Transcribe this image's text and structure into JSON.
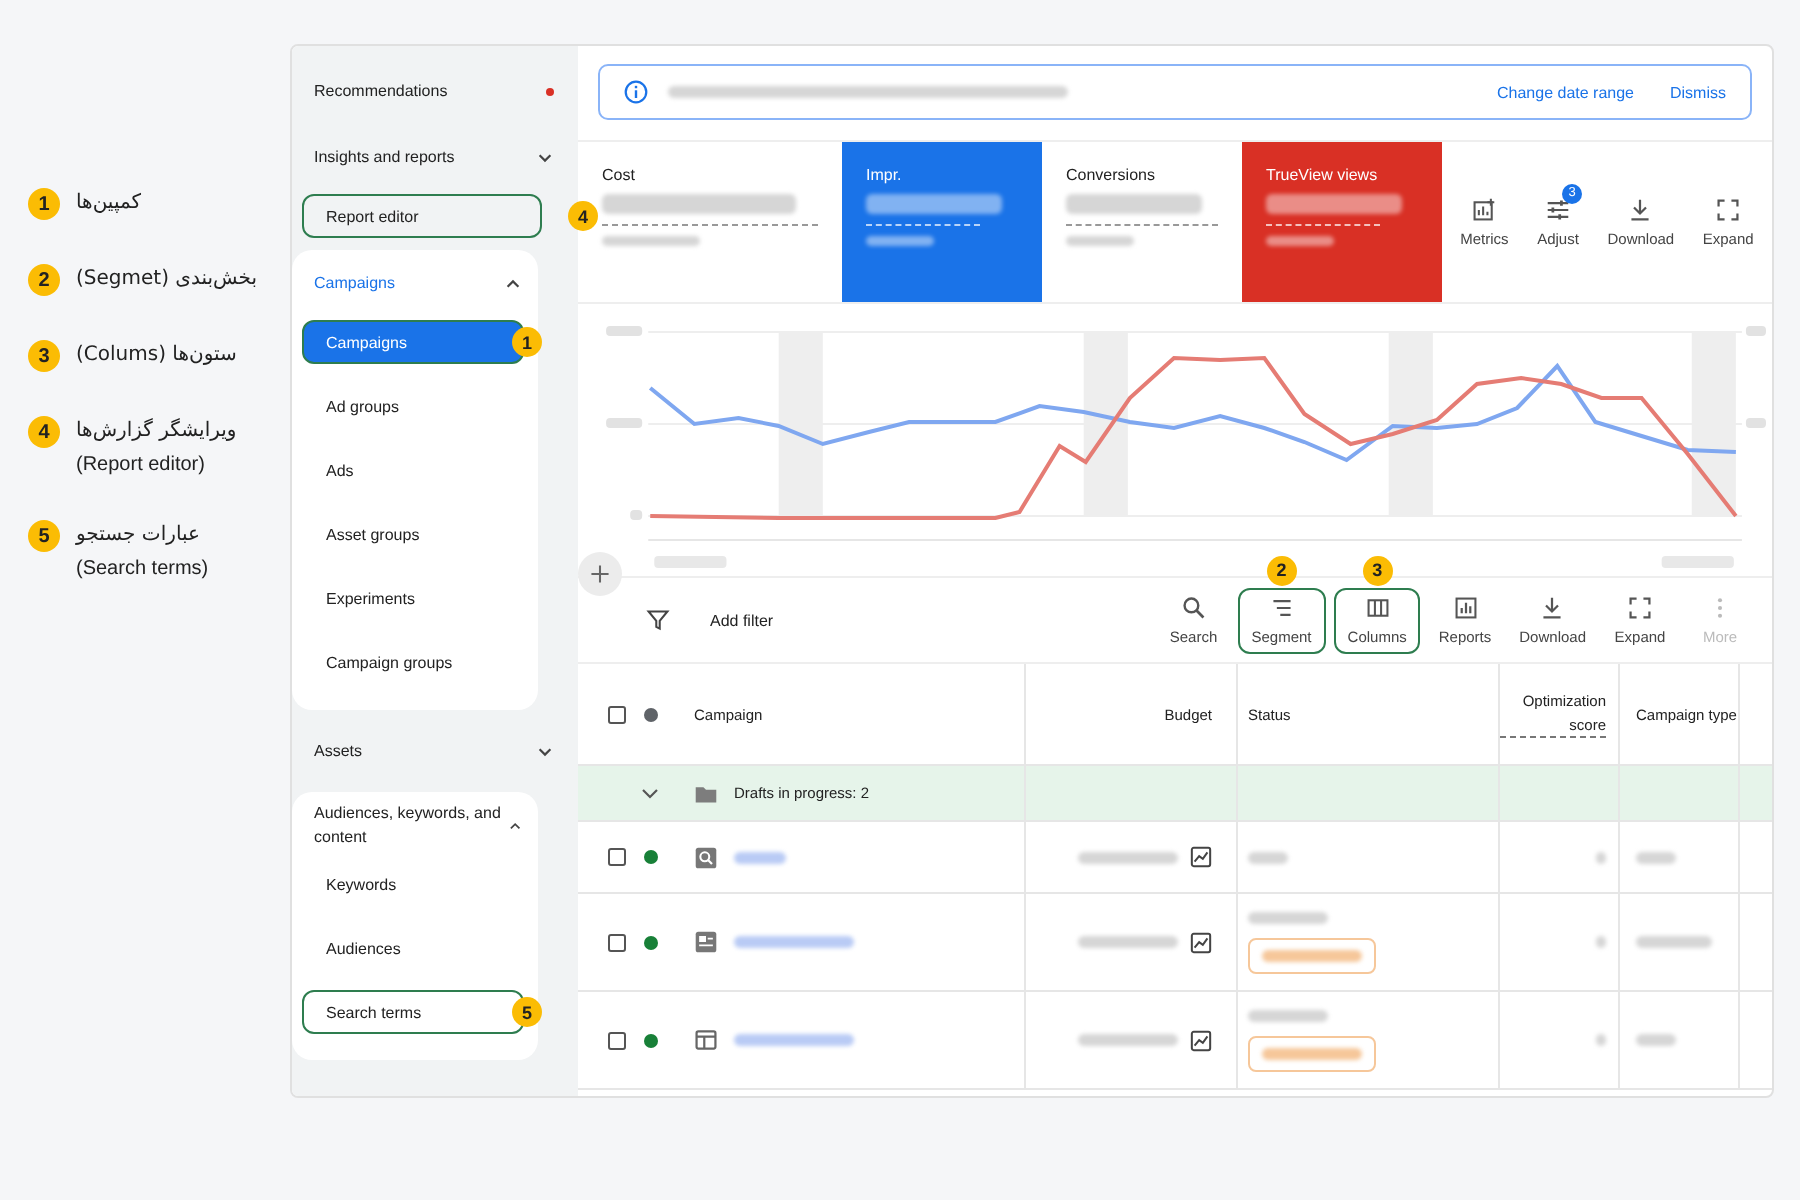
{
  "legend": [
    {
      "number": "1",
      "text": "کمپین‌ها"
    },
    {
      "number": "2",
      "text": "بخش‌بندی (Segmet)"
    },
    {
      "number": "3",
      "text": "ستون‌ها (Colums)"
    },
    {
      "number": "4",
      "text": "ویرایشگر گزارش‌ها",
      "subtext": "(Report editor)"
    },
    {
      "number": "5",
      "text": "عبارات جستجو",
      "subtext": "(Search terms)"
    }
  ],
  "sidebar": {
    "sections": [
      {
        "label": "Recommendations",
        "alert": true,
        "expanded": false,
        "active": false
      },
      {
        "label": "Insights and reports",
        "alert": false,
        "expanded": false,
        "active": false,
        "children": [
          {
            "label": "Report editor",
            "selected": false,
            "callout": "4"
          }
        ]
      },
      {
        "label": "Campaigns",
        "alert": false,
        "expanded": true,
        "active": true,
        "children": [
          {
            "label": "Campaigns",
            "selected": true,
            "callout": "1"
          },
          {
            "label": "Ad groups",
            "selected": false
          },
          {
            "label": "Ads",
            "selected": false
          },
          {
            "label": "Asset groups",
            "selected": false
          },
          {
            "label": "Experiments",
            "selected": false
          },
          {
            "label": "Campaign groups",
            "selected": false
          }
        ]
      },
      {
        "label": "Assets",
        "alert": false,
        "expanded": false,
        "active": false
      },
      {
        "label": "Audiences, keywords, and content",
        "alert": false,
        "expanded": true,
        "active": false,
        "children": [
          {
            "label": "Keywords",
            "selected": false
          },
          {
            "label": "Audiences",
            "selected": false
          },
          {
            "label": "Search terms",
            "selected": false,
            "callout": "5"
          }
        ]
      }
    ]
  },
  "notice": {
    "actions": [
      "Change date range",
      "Dismiss"
    ]
  },
  "metrics": [
    {
      "label": "Cost",
      "color": "#ffffff"
    },
    {
      "label": "Impr.",
      "color": "#1a73e8"
    },
    {
      "label": "Conversions",
      "color": "#ffffff"
    },
    {
      "label": "TrueView views",
      "color": "#d93025"
    }
  ],
  "chart_actions": [
    {
      "label": "Metrics",
      "kind": "metrics"
    },
    {
      "label": "Adjust",
      "kind": "adjust",
      "badge": "3"
    },
    {
      "label": "Download",
      "kind": "download"
    },
    {
      "label": "Expand",
      "kind": "expand"
    }
  ],
  "toolbar": {
    "filter_label": "Add filter",
    "tools": [
      {
        "label": "Search",
        "kind": "search",
        "disabled": false
      },
      {
        "label": "Segment",
        "kind": "segment",
        "disabled": false,
        "callout": "2"
      },
      {
        "label": "Columns",
        "kind": "columns",
        "disabled": false,
        "callout": "3"
      },
      {
        "label": "Reports",
        "kind": "reports",
        "disabled": false
      },
      {
        "label": "Download",
        "kind": "download",
        "disabled": false
      },
      {
        "label": "Expand",
        "kind": "expand",
        "disabled": false
      },
      {
        "label": "More",
        "kind": "more",
        "disabled": true
      }
    ]
  },
  "table": {
    "columns": [
      "Campaign",
      "Budget",
      "Status",
      "Optimization score",
      "Campaign type"
    ],
    "group_row": {
      "label": "Drafts in progress: 2",
      "expanded": true
    },
    "all_checked": false,
    "rows": [
      {
        "checked": false,
        "color": "#188038",
        "kind": "search",
        "limited": false
      },
      {
        "checked": false,
        "color": "#188038",
        "kind": "display",
        "limited": true
      },
      {
        "checked": false,
        "color": "#188038",
        "kind": "video",
        "limited": true
      }
    ]
  }
}
